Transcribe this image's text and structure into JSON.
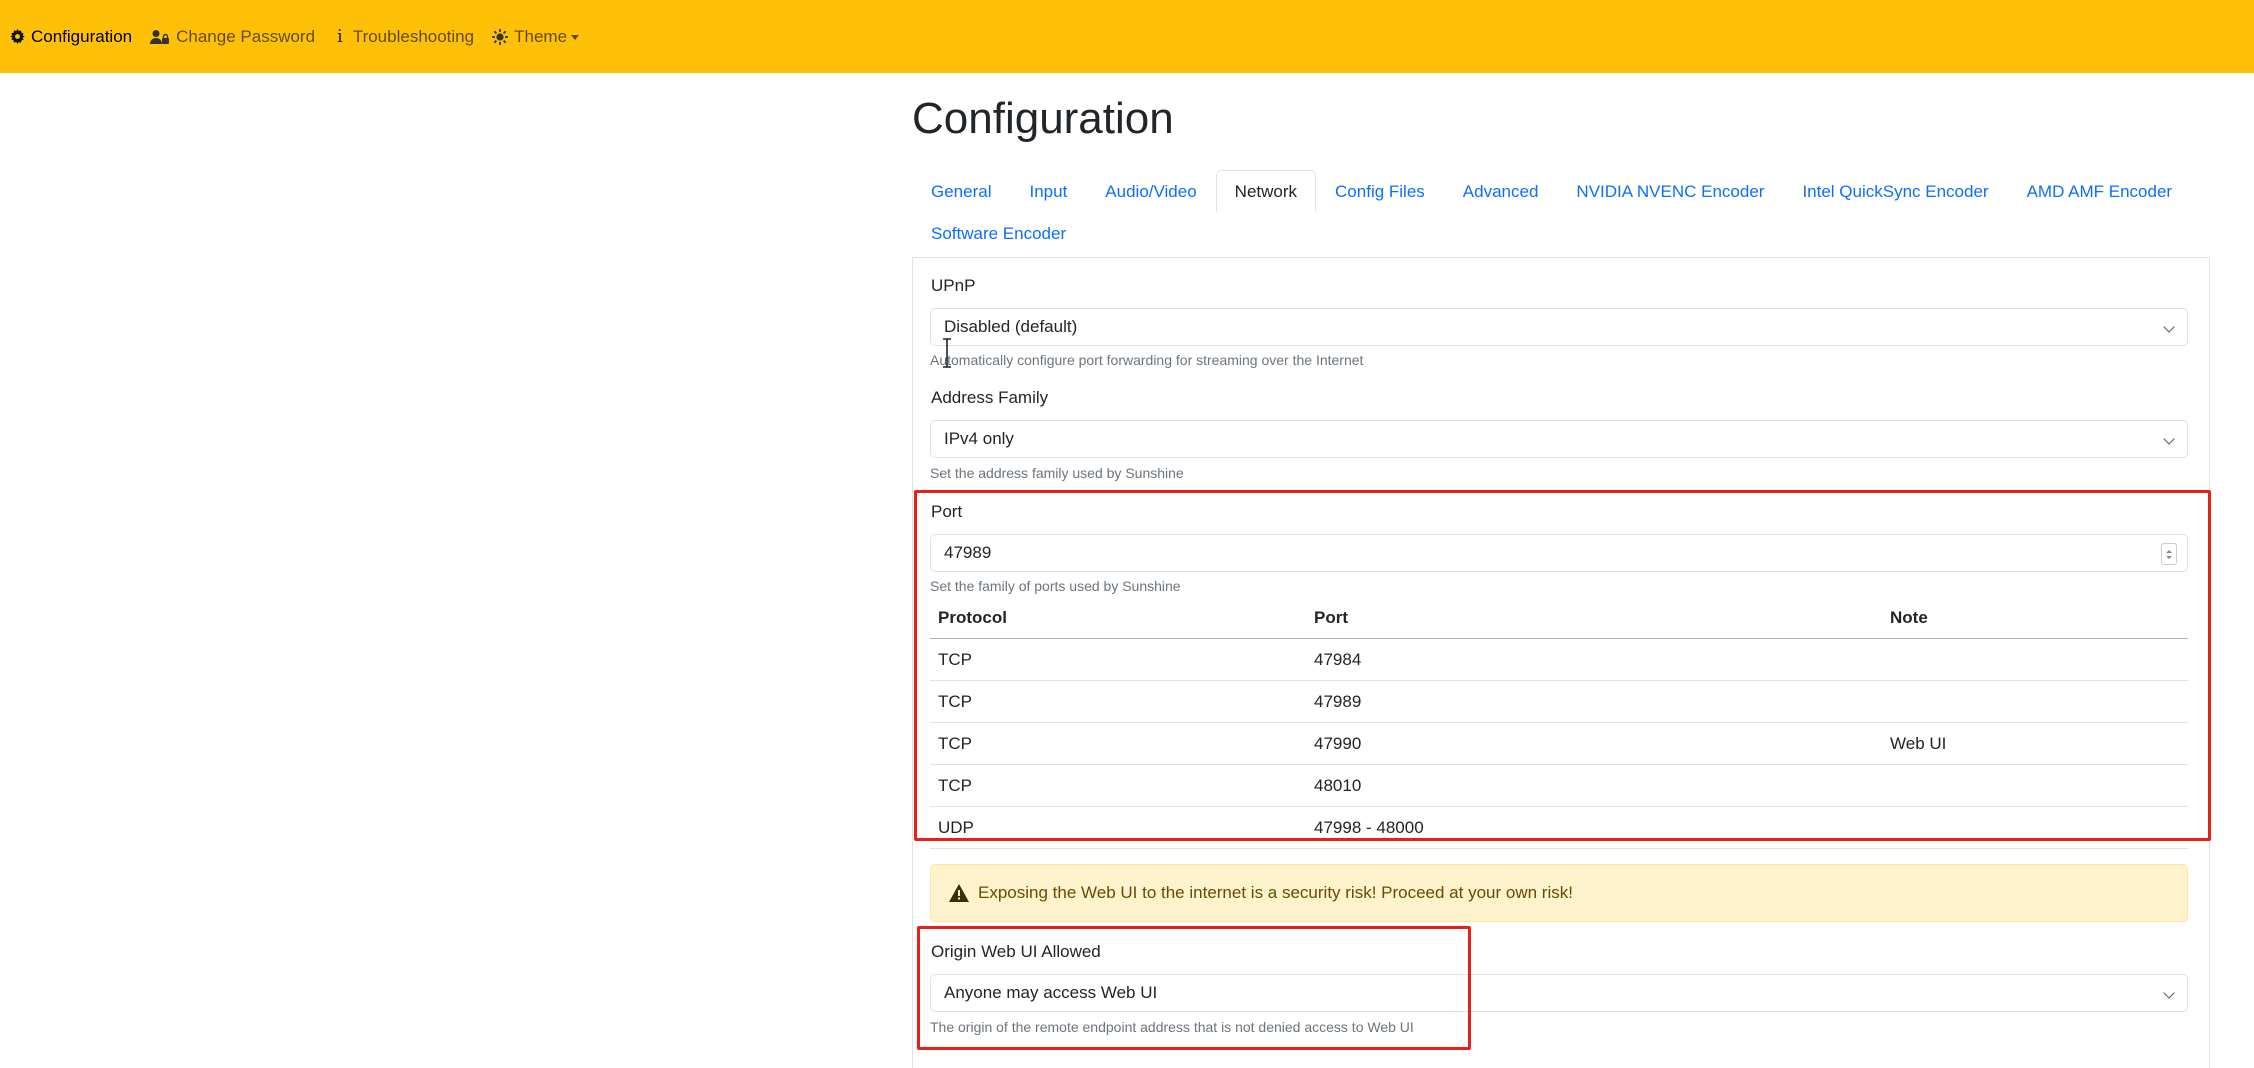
{
  "nav": {
    "items": [
      {
        "label": "Configuration",
        "icon": "gear-icon"
      },
      {
        "label": "Change Password",
        "icon": "user-lock-icon"
      },
      {
        "label": "Troubleshooting",
        "icon": "info-icon"
      },
      {
        "label": "Theme",
        "icon": "sun-icon"
      }
    ],
    "bar_color": "#ffc107"
  },
  "page": {
    "title": "Configuration"
  },
  "tabs": [
    "General",
    "Input",
    "Audio/Video",
    "Network",
    "Config Files",
    "Advanced",
    "NVIDIA NVENC Encoder",
    "Intel QuickSync Encoder",
    "AMD AMF Encoder",
    "Software Encoder"
  ],
  "active_tab": "Network",
  "upnp": {
    "label": "UPnP",
    "value": "Disabled (default)",
    "help": "Automatically configure port forwarding for streaming over the Internet"
  },
  "address_family": {
    "label": "Address Family",
    "value": "IPv4 only",
    "help": "Set the address family used by Sunshine"
  },
  "port": {
    "label": "Port",
    "value": "47989",
    "help": "Set the family of ports used by Sunshine",
    "table": {
      "headers": [
        "Protocol",
        "Port",
        "Note"
      ],
      "rows": [
        [
          "TCP",
          "47984",
          ""
        ],
        [
          "TCP",
          "47989",
          ""
        ],
        [
          "TCP",
          "47990",
          "Web UI"
        ],
        [
          "TCP",
          "48010",
          ""
        ],
        [
          "UDP",
          "47998 - 48000",
          ""
        ]
      ]
    }
  },
  "warning": {
    "text": "Exposing the Web UI to the internet is a security risk! Proceed at your own risk!",
    "icon": "warning-triangle-icon"
  },
  "origin": {
    "label": "Origin Web UI Allowed",
    "value": "Anyone may access Web UI",
    "help": "The origin of the remote endpoint address that is not denied access to Web UI"
  },
  "annotation_color": "#e8201a"
}
